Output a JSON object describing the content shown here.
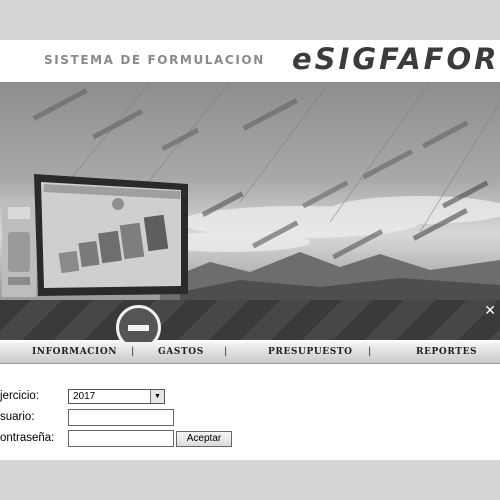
{
  "header": {
    "subtitle": "SISTEMA DE FORMULACION",
    "logo": "eSIGFAFOR"
  },
  "slider": {
    "close_symbol": "✕",
    "pause_icon": "minus-icon"
  },
  "nav": {
    "items": [
      {
        "label": "INFORMACION"
      },
      {
        "label": "GASTOS"
      },
      {
        "label": "PRESUPUESTO"
      },
      {
        "label": "REPORTES"
      }
    ],
    "separator": "|"
  },
  "form": {
    "ejercicio_label": "jercicio:",
    "ejercicio_value": "2017",
    "usuario_label": "suario:",
    "contrasena_label": "ontraseña:",
    "submit_label": "Aceptar"
  }
}
